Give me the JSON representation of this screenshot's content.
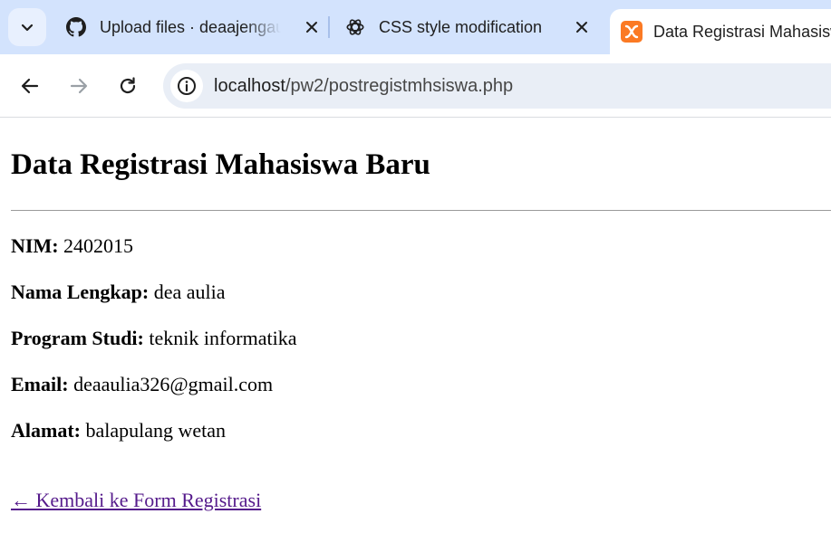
{
  "browser": {
    "tabs": [
      {
        "title": "Upload files · deaajengaulia",
        "icon": "github-icon",
        "active": false
      },
      {
        "title": "CSS style modification",
        "icon": "chatgpt-icon",
        "active": false
      },
      {
        "title": "Data Registrasi Mahasiswa Baru",
        "icon": "xampp-icon",
        "active": true
      }
    ],
    "address": {
      "host": "localhost",
      "path": "/pw2/postregistmhsiswa.php"
    },
    "colors": {
      "tabstrip": "#d3e3fd",
      "omnibox": "#e9eef6",
      "xampp": "#fb7a24"
    }
  },
  "page": {
    "heading": "Data Registrasi Mahasiswa Baru",
    "fields": [
      {
        "label": "NIM:",
        "value": "2402015"
      },
      {
        "label": "Nama Lengkap:",
        "value": "dea aulia"
      },
      {
        "label": "Program Studi:",
        "value": "teknik informatika"
      },
      {
        "label": "Email:",
        "value": "deaaulia326@gmail.com"
      },
      {
        "label": "Alamat:",
        "value": "balapulang wetan"
      }
    ],
    "back_link": "← Kembali ke Form Registrasi",
    "link_color": "#551a8b"
  }
}
